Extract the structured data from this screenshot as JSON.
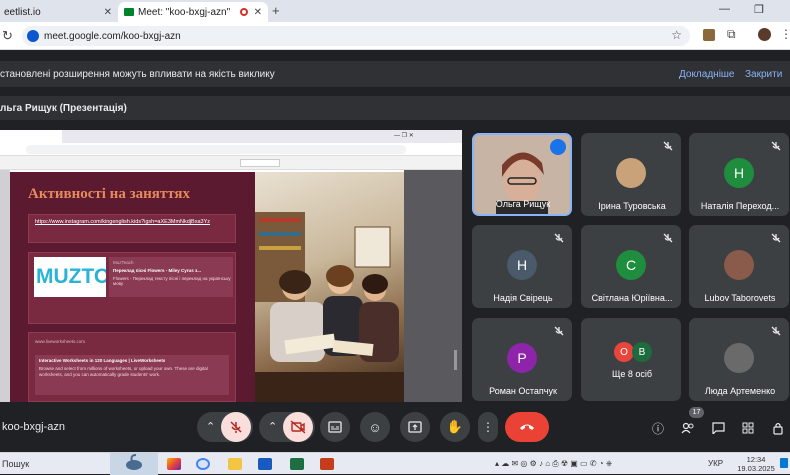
{
  "browser": {
    "tabs": [
      {
        "label": "eetlist.io"
      },
      {
        "label": "Meet: \"koo-bxgj-azn\""
      }
    ],
    "url": "meet.google.com/koo-bxgj-azn"
  },
  "notices": {
    "extensions_warning": "становлені розширення можуть впливати на якість виклику",
    "details_link": "Докладніше",
    "close_link": "Закрити",
    "presenter": "льга Рищук (Презентація)"
  },
  "presentation": {
    "slide_title": "Активності на заняттях",
    "instagram_link": "https://www.instagram.com/kingenglish.kids?igsh=aXE3MmNkdjBxa3Yz",
    "card1_logo": "MUZTO",
    "card1_source": "MuzTeach",
    "card1_title": "Переклад пісні Flowers - Miley Cyrus з...",
    "card1_desc": "Flowers - Переклад тексту пісні і переклад на українську мову",
    "card2_source": "www.liveworksheets.com",
    "card2_title": "Interactive Worksheets in 120 Languages | LiveWorksheets",
    "card2_desc": "Browse and select from millions of worksheets, or upload your own. These are digital worksheets, and you can automatically grade students' work."
  },
  "participants": [
    {
      "name": "Ольга Рищук",
      "initial": "",
      "color": "",
      "speaking": true
    },
    {
      "name": "Ірина Туровська",
      "initial": "",
      "color": "#c9a27a"
    },
    {
      "name": "Наталія Переход...",
      "initial": "Н",
      "color": "#1e8e3e"
    },
    {
      "name": "Надія Свірець",
      "initial": "Н",
      "color": "#4a5a6a"
    },
    {
      "name": "Світлана Юріївна...",
      "initial": "С",
      "color": "#1e8e3e"
    },
    {
      "name": "Lubov Taborovets",
      "initial": "",
      "color": "#8a5a4a"
    },
    {
      "name": "Роман Остапчук",
      "initial": "Р",
      "color": "#8e24aa"
    },
    {
      "name": "Ще 8 осіб",
      "initial": "",
      "color": ""
    },
    {
      "name": "Люда Артеменко",
      "initial": "",
      "color": "#6a6a6a"
    }
  ],
  "more_avatars": [
    {
      "initial": "О",
      "color": "#e8453c"
    },
    {
      "initial": "В",
      "color": "#1e6b3e"
    }
  ],
  "controls": {
    "meeting_code": "koo-bxgj-azn",
    "people_count": "17"
  },
  "taskbar": {
    "search_label": "Пошук",
    "language": "УКР",
    "time": "12:34",
    "date": "19.03.2025"
  },
  "colors": {
    "meet_bg": "#202124",
    "tile_bg": "#3c4043",
    "end_call": "#ea4335",
    "muted_btn": "#f9dedc",
    "link_blue": "#8ab4f8"
  }
}
